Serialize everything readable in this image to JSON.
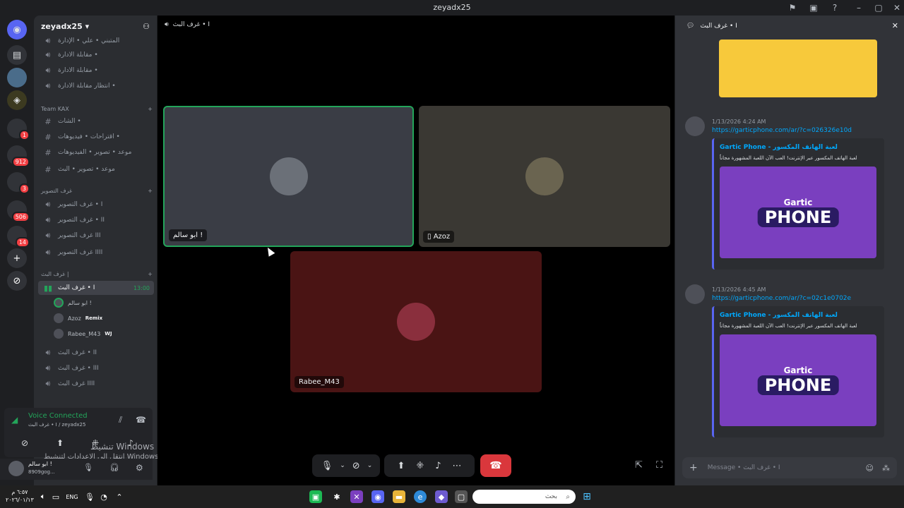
{
  "window": {
    "title": "zeyadx25"
  },
  "rail": {
    "badges": [
      "1",
      "912",
      "3",
      "506",
      "14"
    ]
  },
  "sidebar": {
    "server_name": "zeyadx25 ▾",
    "channels_top": [
      {
        "name": "المتبني • علي • الإدارة",
        "icon": "speaker-icon"
      },
      {
        "name": "مقابلة الادارة •",
        "icon": "speaker-icon"
      },
      {
        "name": "مقابلة الادارة •",
        "icon": "speaker-icon"
      },
      {
        "name": "انتظار مقابلة الادارة •",
        "icon": "speaker-icon"
      }
    ],
    "cat_team": "Team KAX",
    "channels_team": [
      {
        "name": "الشات •"
      },
      {
        "name": "اقتراحات • فيديوهات •"
      },
      {
        "name": "موعد • تصوير • الفيديوهات"
      },
      {
        "name": "موعد • تصوير • البث"
      }
    ],
    "cat_photo": "غرف التصوير",
    "channels_photo": [
      {
        "name": "غرف التصوير • I"
      },
      {
        "name": "غرف التصوير • II"
      },
      {
        "name": "غرف التصوير III"
      },
      {
        "name": "غرف التصوير IIII"
      }
    ],
    "cat_stream": "غرف البث |",
    "active_channel": {
      "name": "غرف البث • I",
      "time": "13:00"
    },
    "members": [
      {
        "name": "ابو سالم !",
        "tag": ""
      },
      {
        "name": "Azoz",
        "tag": "Remix"
      },
      {
        "name": "Rabee_M43",
        "tag": "WJ"
      }
    ],
    "channels_stream": [
      {
        "name": "غرف البث • II"
      },
      {
        "name": "غرف البث • III"
      },
      {
        "name": "غرف البث IIII"
      }
    ],
    "voice": {
      "status": "Voice Connected",
      "channel": "غرف البث • I / zeyadx25"
    },
    "user": {
      "name": "ابو سالم !",
      "sub": "8909gog..."
    },
    "watermark_1": "تنشيط Windows",
    "watermark_2": "انتقل إلى الإعدادات لتنشيط Windows"
  },
  "main": {
    "header": "غرف البث • I",
    "tiles": [
      {
        "label": "ابو سالم !"
      },
      {
        "label": "Azoz"
      },
      {
        "label": "Rabee_M43"
      }
    ]
  },
  "chat": {
    "header": "غرف البث • I",
    "messages": [
      {
        "time": "1/13/2026 4:24 AM",
        "link": "https://garticphone.com/ar/?c=026326e10d"
      },
      {
        "time": "1/13/2026 4:45 AM",
        "link": "https://garticphone.com/ar/?c=02c1e0702e"
      }
    ],
    "embed": {
      "site": "Gartic Phone - لعبة الهاتف المكسور",
      "desc": "لعبة الهاتف المكسور عبر الإنترنت! العب الآن اللعبة المشهورة مجاناً",
      "brand_top": "Gartic",
      "brand_main": "PHONE"
    },
    "input_placeholder": "Message • غرف البث • I"
  },
  "taskbar": {
    "lang": "ENG",
    "search": "بحث",
    "clock_time": "٦:٥٧ م",
    "clock_date": "٢٠٢٦/٠١/١٣"
  },
  "colors": {
    "speaking_green": "#23a55a",
    "hangup_red": "#da373c",
    "link_blue": "#00a8fc"
  }
}
